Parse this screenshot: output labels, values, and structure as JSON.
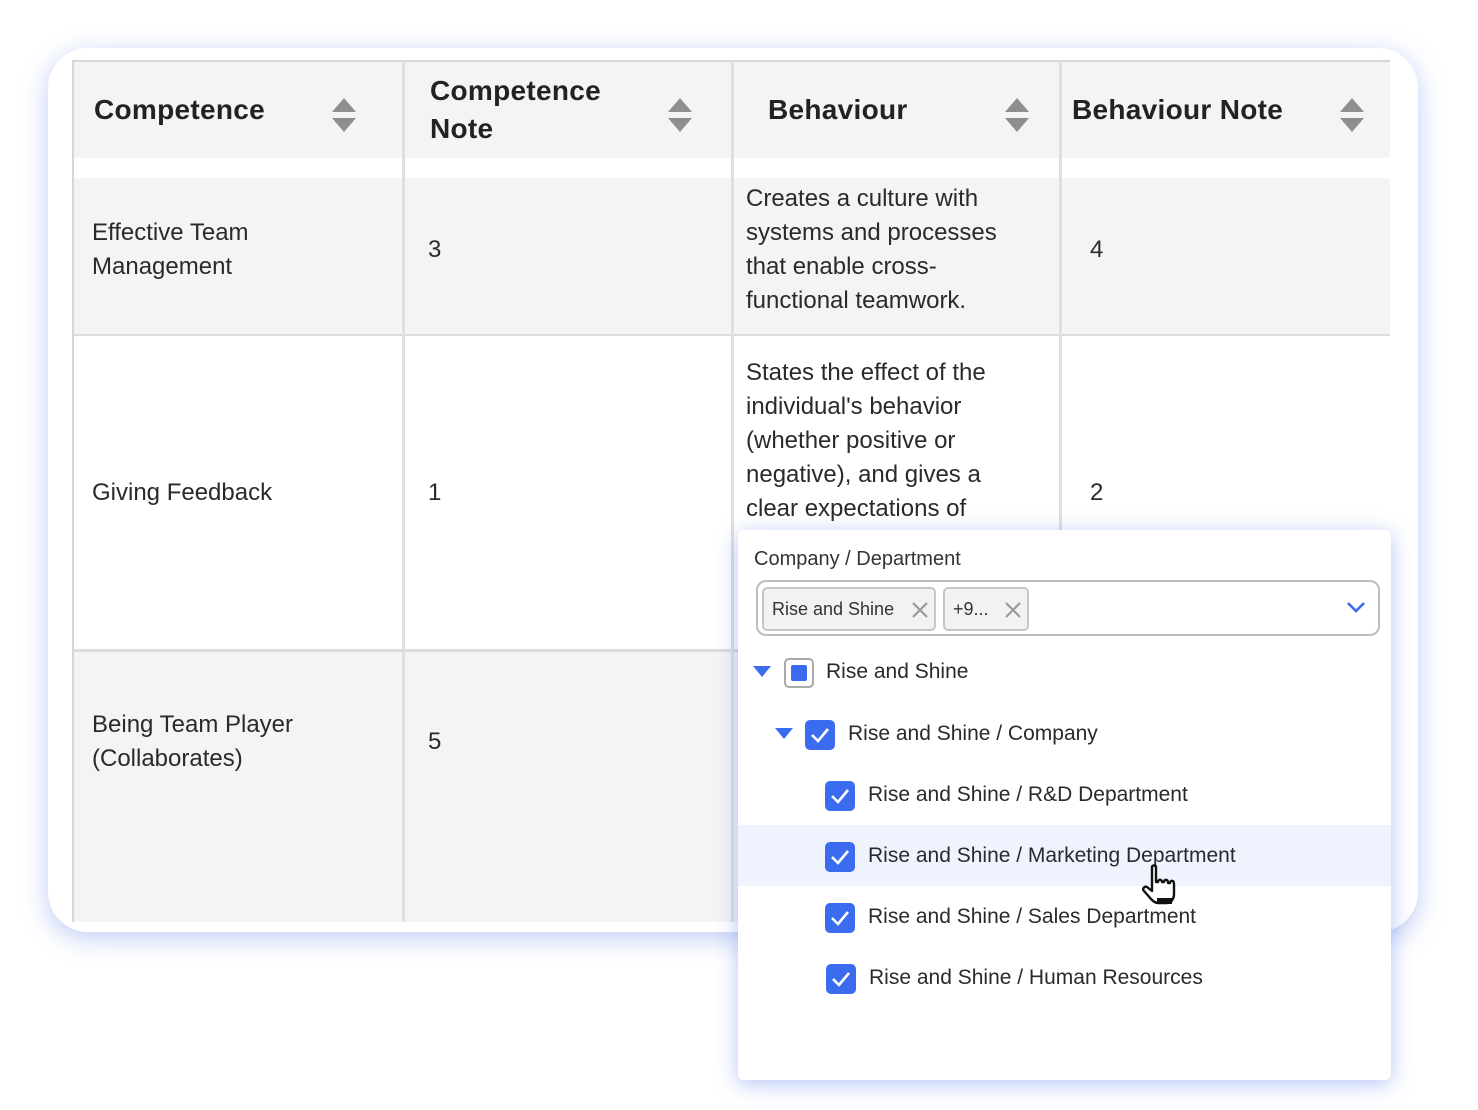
{
  "table": {
    "headers": [
      {
        "label": "Competence"
      },
      {
        "label": "Competence Note"
      },
      {
        "label": "Behaviour"
      },
      {
        "label": "Behaviour Note"
      }
    ],
    "rows": [
      {
        "competence": "Effective Team Management",
        "competence_note": "3",
        "behaviour": "Creates a culture with systems and processes that enable cross-functional teamwork.",
        "behaviour_note": "4"
      },
      {
        "competence": "Giving Feedback",
        "competence_note": "1",
        "behaviour": "States the effect of the individual's behavior (whether positive or negative), and gives a clear expectations of",
        "behaviour_note": "2"
      },
      {
        "competence": "Being Team Player (Collaborates)",
        "competence_note": "5",
        "behaviour": "",
        "behaviour_note": ""
      }
    ]
  },
  "dropdown": {
    "label": "Company / Department",
    "chips": [
      "Rise and Shine",
      "+9..."
    ],
    "options": [
      {
        "label": "Rise and Shine",
        "state": "partial",
        "expanded": true
      },
      {
        "label": "Rise and Shine / Company",
        "state": "checked",
        "expanded": true
      },
      {
        "label": "Rise and Shine / R&D Department",
        "state": "checked"
      },
      {
        "label": "Rise and Shine / Marketing Department",
        "state": "checked",
        "hovered": true
      },
      {
        "label": "Rise and Shine / Sales Department",
        "state": "checked"
      },
      {
        "label": "Rise and Shine / Human Resources",
        "state": "checked"
      }
    ]
  },
  "colors": {
    "accent": "#3b6cf0",
    "header_bg": "#f4f4f4",
    "hover_bg": "#eef3fd"
  }
}
